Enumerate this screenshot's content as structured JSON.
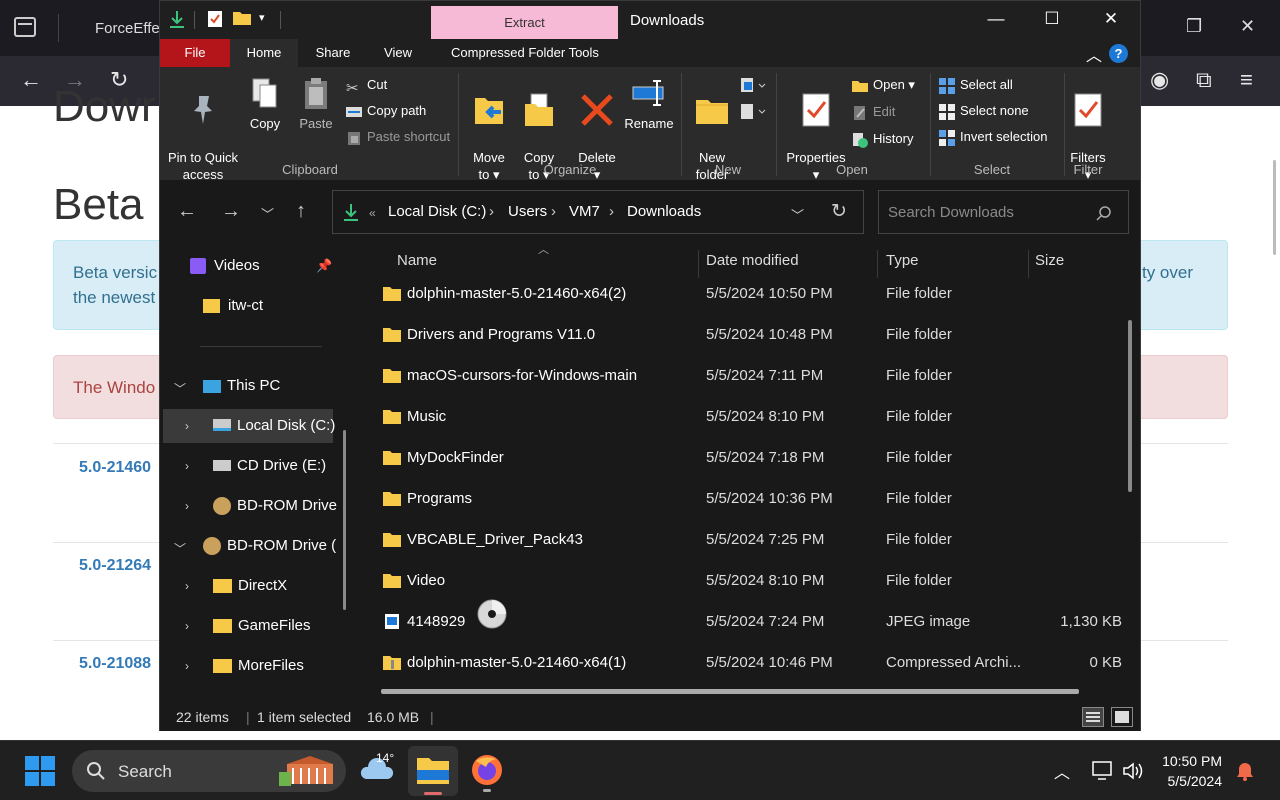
{
  "browser": {
    "tab_title": "ForceEffe",
    "page_heading_1": "Dowr",
    "page_heading_2": "Beta",
    "info_line_1": "Beta versic",
    "info_line_2": "the newest",
    "info_line_right": "ty over",
    "warning_text": "The Windo",
    "versions": [
      "5.0-21460",
      "5.0-21264",
      "5.0-21088"
    ]
  },
  "explorer": {
    "window_title": "Downloads",
    "context_tab": "Extract",
    "menu": {
      "file": "File",
      "home": "Home",
      "share": "Share",
      "view": "View",
      "compressed": "Compressed Folder Tools"
    },
    "ribbon": {
      "pin_label": "Pin to Quick\naccess",
      "copy": "Copy",
      "paste": "Paste",
      "cut": "Cut",
      "copy_path": "Copy path",
      "paste_shortcut": "Paste shortcut",
      "clipboard": "Clipboard",
      "move_to": "Move\nto ▾",
      "copy_to": "Copy\nto ▾",
      "delete": "Delete\n▾",
      "rename": "Rename",
      "organize": "Organize",
      "new_folder": "New\nfolder",
      "new": "New",
      "properties": "Properties\n▾",
      "open": "Open ▾",
      "edit": "Edit",
      "history": "History",
      "open_group": "Open",
      "select_all": "Select all",
      "select_none": "Select none",
      "invert_selection": "Invert selection",
      "select_group": "Select",
      "filters": "Filters\n▾",
      "filter_group": "Filter"
    },
    "address": {
      "crumbs": [
        "Local Disk (C:)",
        "Users",
        "VM7",
        "Downloads"
      ],
      "search_placeholder": "Search Downloads"
    },
    "nav": [
      {
        "label": "Videos"
      },
      {
        "label": "itw-ct"
      },
      {
        "label": "This PC"
      },
      {
        "label": "Local Disk (C:)"
      },
      {
        "label": "CD Drive (E:)"
      },
      {
        "label": "BD-ROM Drive"
      },
      {
        "label": "BD-ROM Drive ("
      },
      {
        "label": "DirectX"
      },
      {
        "label": "GameFiles"
      },
      {
        "label": "MoreFiles"
      }
    ],
    "columns": {
      "name": "Name",
      "date": "Date modified",
      "type": "Type",
      "size": "Size"
    },
    "files": [
      {
        "name": "dolphin-master-5.0-21460-x64(2)",
        "date": "5/5/2024 10:50 PM",
        "type": "File folder",
        "size": ""
      },
      {
        "name": "Drivers and Programs V11.0",
        "date": "5/5/2024 10:48 PM",
        "type": "File folder",
        "size": ""
      },
      {
        "name": "macOS-cursors-for-Windows-main",
        "date": "5/5/2024 7:11 PM",
        "type": "File folder",
        "size": ""
      },
      {
        "name": "Music",
        "date": "5/5/2024 8:10 PM",
        "type": "File folder",
        "size": ""
      },
      {
        "name": "MyDockFinder",
        "date": "5/5/2024 7:18 PM",
        "type": "File folder",
        "size": ""
      },
      {
        "name": "Programs",
        "date": "5/5/2024 10:36 PM",
        "type": "File folder",
        "size": ""
      },
      {
        "name": "VBCABLE_Driver_Pack43",
        "date": "5/5/2024 7:25 PM",
        "type": "File folder",
        "size": ""
      },
      {
        "name": "Video",
        "date": "5/5/2024 8:10 PM",
        "type": "File folder",
        "size": ""
      },
      {
        "name": "4148929",
        "date": "5/5/2024 7:24 PM",
        "type": "JPEG image",
        "size": "1,130 KB"
      },
      {
        "name": "dolphin-master-5.0-21460-x64(1)",
        "date": "5/5/2024 10:46 PM",
        "type": "Compressed Archi...",
        "size": "0 KB"
      }
    ],
    "status": {
      "items": "22 items",
      "selected": "1 item selected",
      "size": "16.0 MB"
    }
  },
  "taskbar": {
    "search_label": "Search",
    "weather_temp": "14°",
    "time": "10:50 PM",
    "date": "5/5/2024"
  }
}
